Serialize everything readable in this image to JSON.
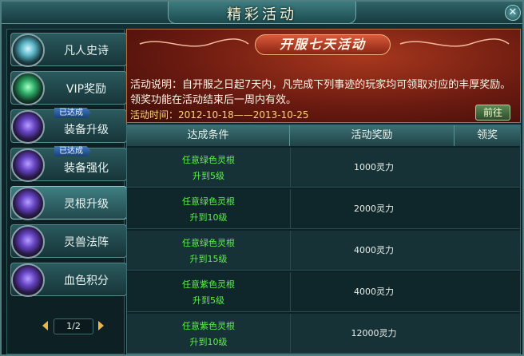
{
  "window": {
    "title": "精彩活动",
    "close_icon": "close-icon"
  },
  "sidebar": {
    "items": [
      {
        "label": "凡人史诗",
        "icon": "scroll-icon",
        "done": ""
      },
      {
        "label": "VIP奖励",
        "icon": "vip-orb-icon",
        "done": ""
      },
      {
        "label": "装备升级",
        "icon": "purple-orb-icon",
        "done": "已达成"
      },
      {
        "label": "装备强化",
        "icon": "purple-orb-icon",
        "done": "已达成"
      },
      {
        "label": "灵根升级",
        "icon": "purple-orb-icon",
        "done": ""
      },
      {
        "label": "灵兽法阵",
        "icon": "purple-orb-icon",
        "done": ""
      },
      {
        "label": "血色积分",
        "icon": "purple-orb-icon",
        "done": ""
      }
    ],
    "pager": "1/2"
  },
  "banner": {
    "title": "开服七天活动",
    "desc": "活动说明：自开服之日起7天内，凡完成下列事迹的玩家均可领取对应的丰厚奖励。领奖功能在活动结束后一周内有效。",
    "time": "活动时间：2012-10-18——2013-10-25",
    "go_label": "前往"
  },
  "table": {
    "headers": [
      "达成条件",
      "活动奖励",
      "领奖"
    ],
    "rows": [
      {
        "cond1": "任意绿色灵根",
        "cond2": "升到5级",
        "reward": "1000灵力"
      },
      {
        "cond1": "任意绿色灵根",
        "cond2": "升到10级",
        "reward": "2000灵力"
      },
      {
        "cond1": "任意绿色灵根",
        "cond2": "升到15级",
        "reward": "4000灵力"
      },
      {
        "cond1": "任意紫色灵根",
        "cond2": "升到5级",
        "reward": "4000灵力"
      },
      {
        "cond1": "任意紫色灵根",
        "cond2": "升到10级",
        "reward": "12000灵力"
      }
    ]
  },
  "colors": {
    "condition_text": "#5ef04a",
    "banner_bg": "#8a2414",
    "accent": "#e8b64a"
  }
}
